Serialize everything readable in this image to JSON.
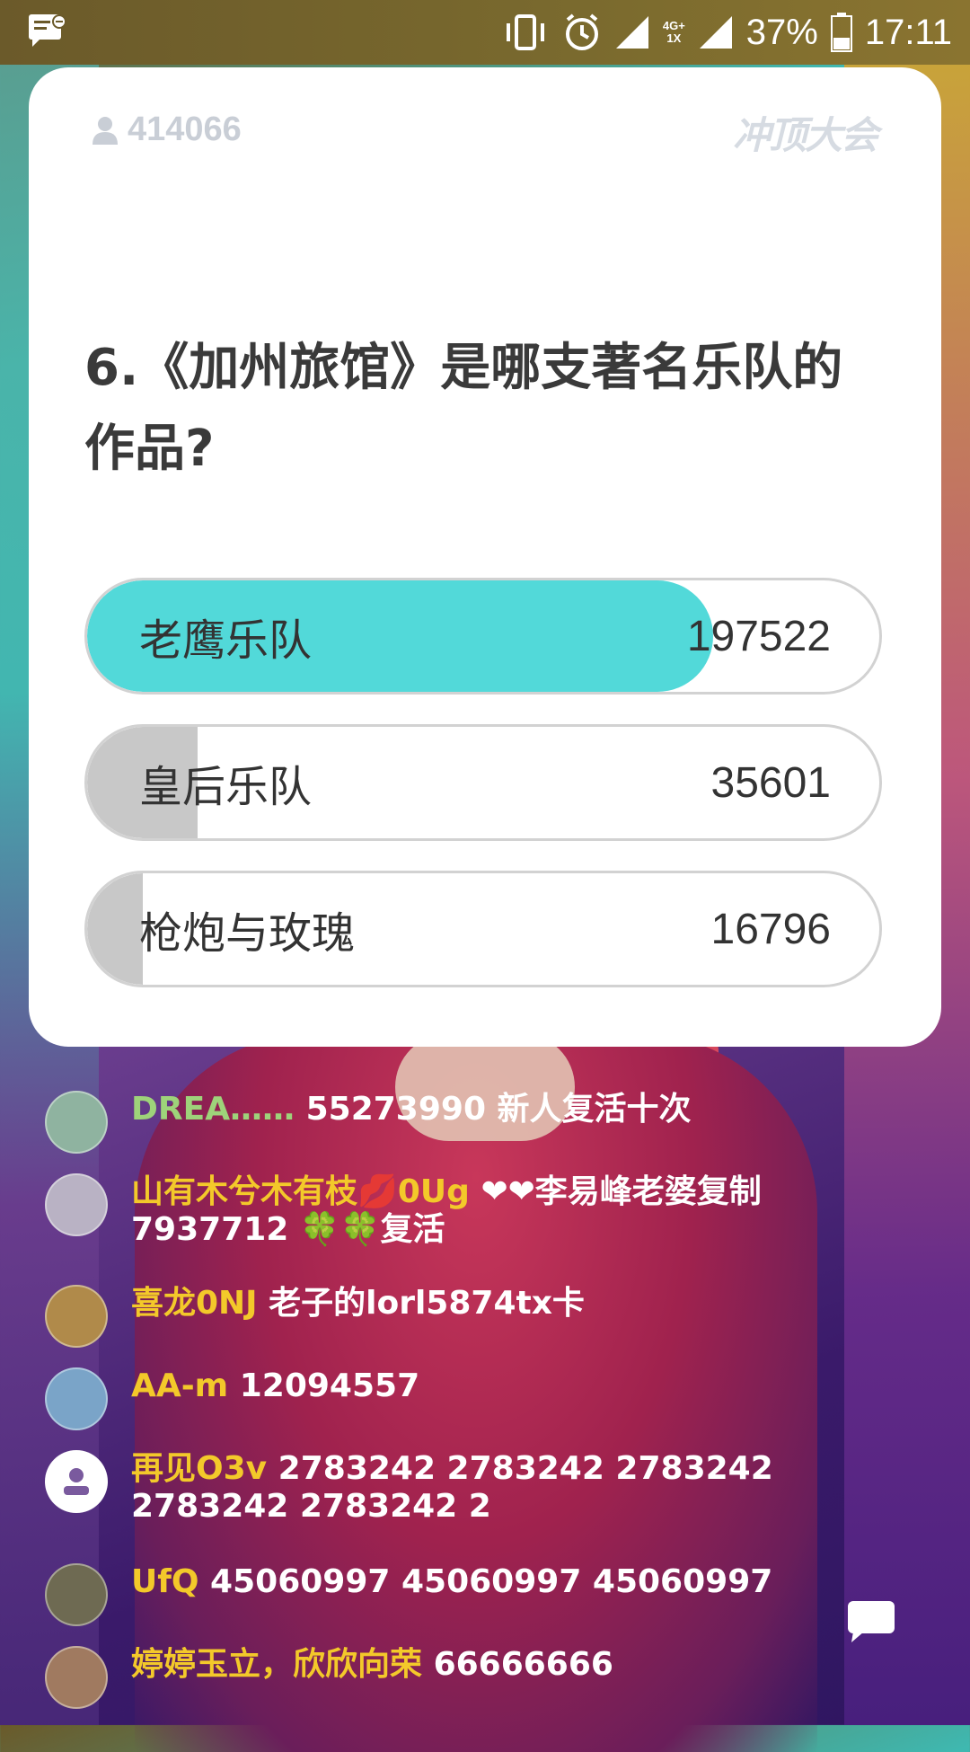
{
  "status_bar": {
    "battery": "37%",
    "time": "17:11",
    "network_top": "4G+",
    "network_bottom": "1X"
  },
  "quiz": {
    "viewer_count": "414066",
    "brand": "冲顶大会",
    "question": "6.《加州旅馆》是哪支著名乐队的作品?",
    "options": [
      {
        "label": "老鹰乐队",
        "count": "197522",
        "share": 0.79,
        "color": "#52d9d9"
      },
      {
        "label": "皇后乐队",
        "count": "35601",
        "share": 0.14,
        "color": "#c8c8c8"
      },
      {
        "label": "枪炮与玫瑰",
        "count": "16796",
        "share": 0.07,
        "color": "#c8c8c8"
      }
    ]
  },
  "comments": [
    {
      "user": "DREA……",
      "text": "55273990 新人复活十次",
      "avatar_color": "#8fb3a0"
    },
    {
      "user": "山有木兮木有枝💋0Ug",
      "text": "❤❤李易峰老婆复制7937712 🍀🍀复活",
      "avatar_color": "#b9b2c4"
    },
    {
      "user": "喜龙0NJ",
      "text": "老子的lorl5874tx卡",
      "avatar_color": "#b08a4a"
    },
    {
      "user": "AA-m",
      "text": "12094557",
      "avatar_color": "#7aa4c8"
    },
    {
      "user": "再见O3v",
      "text": "2783242   2783242  2783242   2783242 2783242   2",
      "avatar_color": "#ffffff"
    },
    {
      "user": "UfQ",
      "text": "45060997   45060997   45060997",
      "avatar_color": "#6e6a52"
    },
    {
      "user": "婷婷玉立，欣欣向荣",
      "text": "66666666",
      "avatar_color": "#a07a60"
    }
  ]
}
